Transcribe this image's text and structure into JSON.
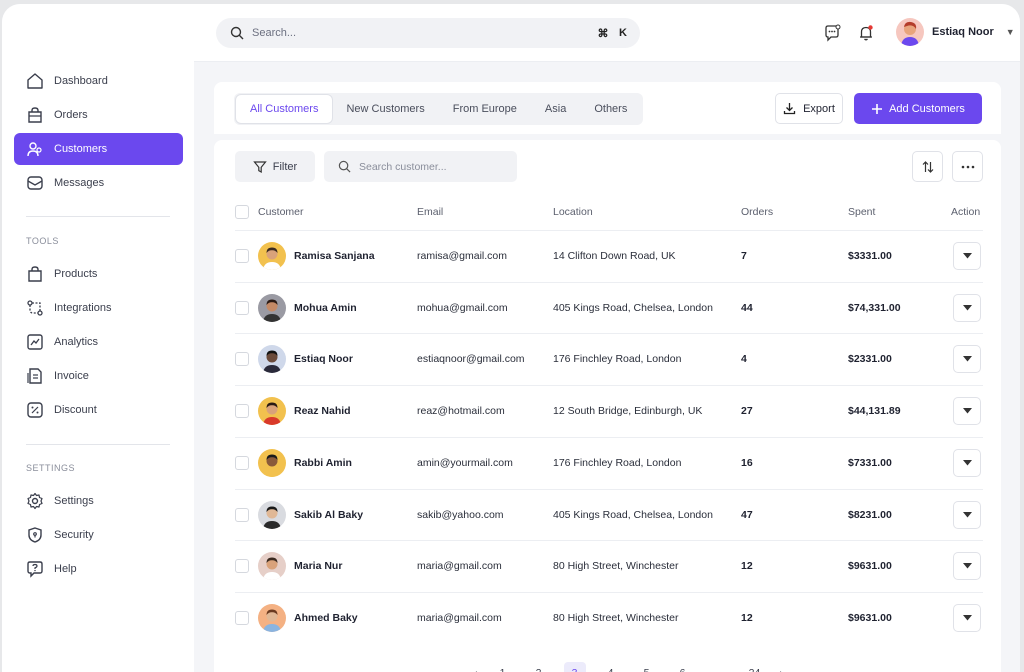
{
  "topbar": {
    "search_placeholder": "Search...",
    "shortcut": [
      "⌘",
      "K"
    ],
    "user_name": "Estiaq Noor"
  },
  "sidebar": {
    "main_items": [
      {
        "label": "Dashboard",
        "icon": "home-icon"
      },
      {
        "label": "Orders",
        "icon": "bag-icon"
      },
      {
        "label": "Customers",
        "icon": "users-icon",
        "active": true
      },
      {
        "label": "Messages",
        "icon": "message-icon"
      }
    ],
    "tools_label": "TOOLS",
    "tools_items": [
      {
        "label": "Products",
        "icon": "box-icon"
      },
      {
        "label": "Integrations",
        "icon": "integrations-icon"
      },
      {
        "label": "Analytics",
        "icon": "analytics-icon"
      },
      {
        "label": "Invoice",
        "icon": "invoice-icon"
      },
      {
        "label": "Discount",
        "icon": "discount-icon"
      }
    ],
    "settings_label": "SETTINGS",
    "settings_items": [
      {
        "label": "Settings",
        "icon": "gear-icon"
      },
      {
        "label": "Security",
        "icon": "shield-icon"
      },
      {
        "label": "Help",
        "icon": "help-icon"
      }
    ]
  },
  "tabs": [
    "All Customers",
    "New Customers",
    "From Europe",
    "Asia",
    "Others"
  ],
  "buttons": {
    "export": "Export",
    "add": "Add Customers",
    "filter": "Filter"
  },
  "table_search_placeholder": "Search customer...",
  "columns": {
    "customer": "Customer",
    "email": "Email",
    "location": "Location",
    "orders": "Orders",
    "spent": "Spent",
    "action": "Action"
  },
  "rows": [
    {
      "name": "Ramisa Sanjana",
      "email": "ramisa@gmail.com",
      "location": "14 Clifton Down Road, UK",
      "orders": "7",
      "spent": "$3331.00"
    },
    {
      "name": "Mohua Amin",
      "email": "mohua@gmail.com",
      "location": "405 Kings Road, Chelsea, London",
      "orders": "44",
      "spent": "$74,331.00"
    },
    {
      "name": "Estiaq Noor",
      "email": "estiaqnoor@gmail.com",
      "location": "176 Finchley Road, London",
      "orders": "4",
      "spent": "$2331.00"
    },
    {
      "name": "Reaz Nahid",
      "email": "reaz@hotmail.com",
      "location": "12 South Bridge, Edinburgh, UK",
      "orders": "27",
      "spent": "$44,131.89"
    },
    {
      "name": "Rabbi Amin",
      "email": "amin@yourmail.com",
      "location": "176 Finchley Road, London",
      "orders": "16",
      "spent": "$7331.00"
    },
    {
      "name": "Sakib Al Baky",
      "email": "sakib@yahoo.com",
      "location": "405 Kings Road, Chelsea, London",
      "orders": "47",
      "spent": "$8231.00"
    },
    {
      "name": "Maria Nur",
      "email": "maria@gmail.com",
      "location": "80 High Street, Winchester",
      "orders": "12",
      "spent": "$9631.00"
    },
    {
      "name": "Ahmed Baky",
      "email": "maria@gmail.com",
      "location": "80 High Street, Winchester",
      "orders": "12",
      "spent": "$9631.00"
    }
  ],
  "pagination": [
    "1",
    "2",
    "3",
    "4",
    "5",
    "6",
    "...",
    "24"
  ],
  "pagination_current": "3",
  "colors": {
    "accent": "#6b48ee",
    "avatars": [
      "#f2c14e",
      "#9a9aa3",
      "#cfd8ea",
      "#f2c14e",
      "#f2c14e",
      "#d9dbe0",
      "#e6cfc8",
      "#f4b183"
    ]
  }
}
